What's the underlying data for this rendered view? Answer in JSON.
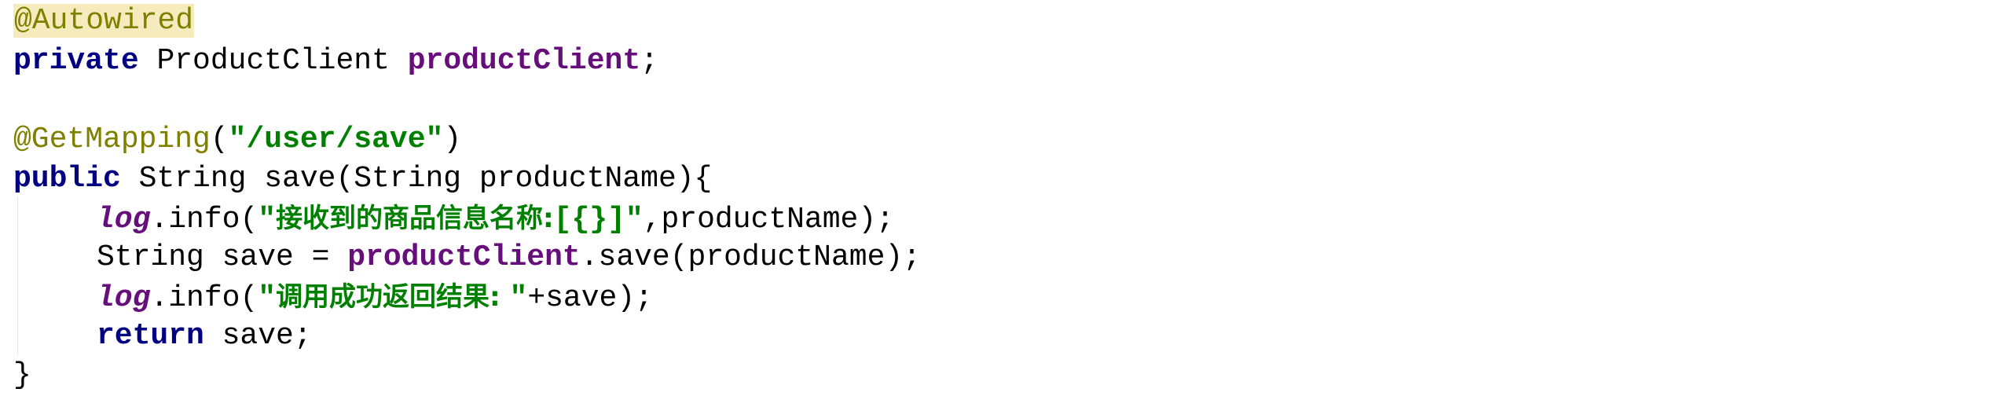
{
  "code": {
    "line1": {
      "annotation": "@Autowired"
    },
    "line2": {
      "keyword": "private",
      "type": "ProductClient",
      "field": "productClient",
      "end": ";"
    },
    "line4": {
      "annotation": "@GetMapping",
      "open": "(",
      "string": "\"/user/save\"",
      "close": ")"
    },
    "line5": {
      "keyword": "public",
      "signature": "String save(String productName){"
    },
    "line6": {
      "log": "log",
      "call": ".info(",
      "string_open": "\"",
      "string_cjk": "接收到的商品信息名称:",
      "string_tail": "[{}]\"",
      "rest": ",productName);"
    },
    "line7": {
      "prefix": "String save = ",
      "field": "productClient",
      "rest": ".save(productName);"
    },
    "line8": {
      "log": "log",
      "call": ".info(",
      "string_open": "\"",
      "string_cjk": "调用成功返回结果: ",
      "string_tail": "\"",
      "rest": "+save);"
    },
    "line9": {
      "keyword": "return",
      "rest": " save;"
    },
    "line10": {
      "brace": "}"
    }
  },
  "colors": {
    "background": "#ffffff",
    "annotation": "#808000",
    "annotation_highlight": "#f6ebbc",
    "keyword": "#000080",
    "field": "#660e7a",
    "string": "#008000",
    "plain": "#000000"
  }
}
